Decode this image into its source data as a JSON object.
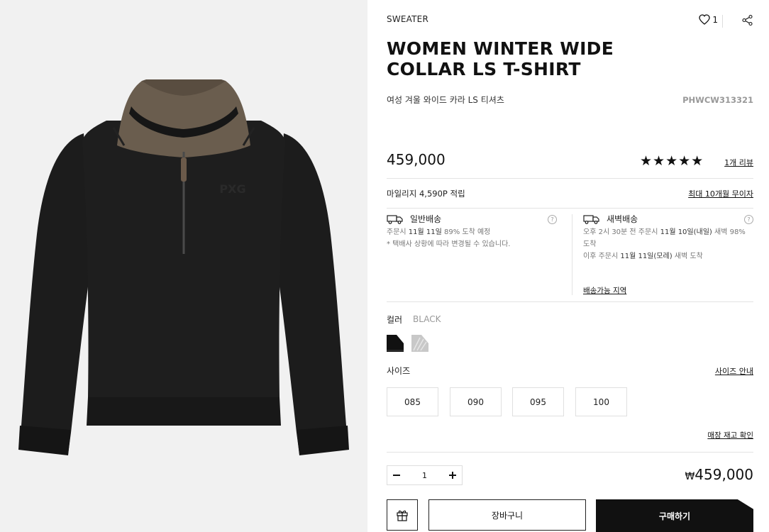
{
  "product": {
    "category": "SWEATER",
    "title_line1": "WOMEN WINTER WIDE",
    "title_line2": "COLLAR LS T-SHIRT",
    "subtitle": "여성 겨울 와이드 카라 LS 티셔츠",
    "code": "PHWCW313321",
    "likes": "1",
    "price": "459,000",
    "rating_stars": "★★★★★",
    "review_link": "1개 리뷰",
    "logo_text": "PXG"
  },
  "mileage": {
    "text": "마일리지 4,590P 적립",
    "installment_link": "최대 10개월 무이자"
  },
  "shipping": {
    "standard": {
      "title": "일반배송",
      "line1_prefix": "주문시 ",
      "line1_date": "11월 11일",
      "line1_suffix": " 89% 도착 예정",
      "line2": "* 택배사 상황에 따라 변경될 수 있습니다."
    },
    "dawn": {
      "title": "새벽배송",
      "line1_prefix": "오후 2시 30분 전 주문시 ",
      "line1_date": "11월 10일(내일)",
      "line1_suffix": " 새벽 98%",
      "line2": "도착",
      "line3_prefix": "이후 주문시 ",
      "line3_date": "11월 11일(모레)",
      "line3_suffix": " 새벽 도착",
      "region_link": "배송가능 지역"
    }
  },
  "color": {
    "label": "컬러",
    "selected": "BLACK",
    "swatches": [
      "#111111",
      "#c8c8c8"
    ]
  },
  "size": {
    "label": "사이즈",
    "guide_link": "사이즈 안내",
    "options": [
      "085",
      "090",
      "095",
      "100"
    ],
    "stock_link": "매장 재고 확인"
  },
  "order": {
    "quantity": "1",
    "total_currency": "₩",
    "total_amount": "459,000",
    "cart_label": "장바구니",
    "buy_label": "구매하기"
  }
}
